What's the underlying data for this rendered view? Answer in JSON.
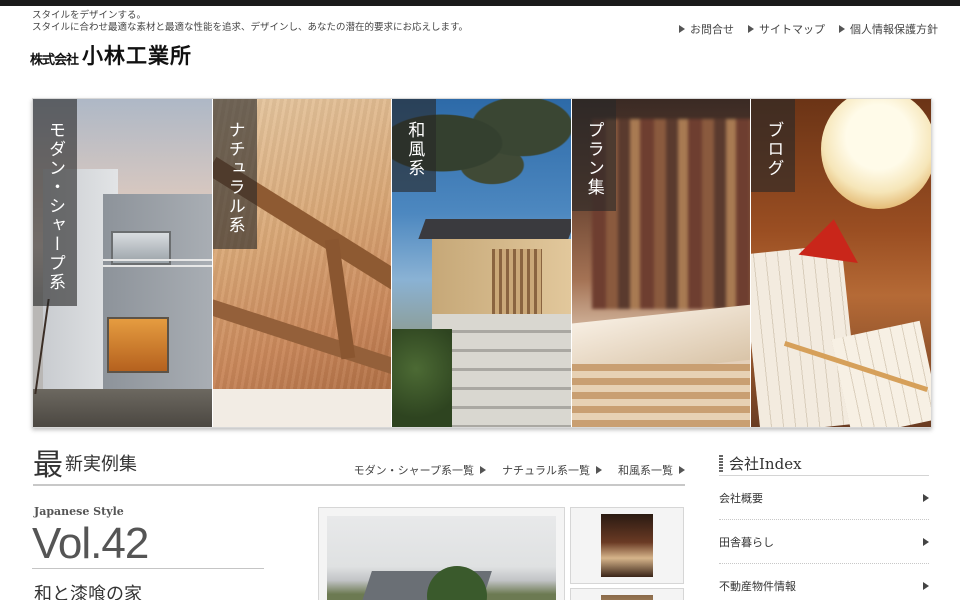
{
  "header": {
    "tagline_line1": "スタイルをデザインする。",
    "tagline_line2": "スタイルに合わせ最適な素材と最適な性能を追求、デザインし、あなたの潜在的要求にお応えします。",
    "brand_prefix": "株式会社",
    "brand_name": "小林工業所",
    "util_nav": [
      "お問合せ",
      "サイトマップ",
      "個人情報保護方針"
    ]
  },
  "hero": {
    "panels": [
      {
        "label": "モダン・シャープ系"
      },
      {
        "label": "ナチュラル系"
      },
      {
        "label": "和風系"
      },
      {
        "label": "プラン集"
      },
      {
        "label": "ブログ"
      }
    ]
  },
  "works": {
    "title_big": "最",
    "title_rest": "新実例集",
    "links": [
      "モダン・シャープ系一覧",
      "ナチュラル系一覧",
      "和風系一覧"
    ],
    "style_label": "Japanese Style",
    "vol": "Vol.42",
    "work_name": "和と漆喰の家"
  },
  "company_index": {
    "title": "会社Index",
    "items": [
      "会社概要",
      "田舎暮らし",
      "不動産物件情報"
    ]
  },
  "colors": {
    "top_bar": "#1a1a1a",
    "panel_label_bg": "rgba(40,40,40,0.62)"
  }
}
